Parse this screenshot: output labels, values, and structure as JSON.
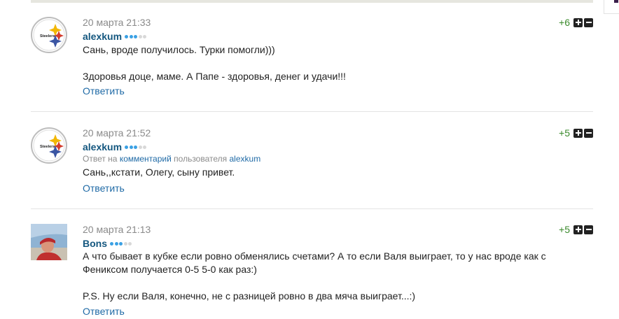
{
  "comments": [
    {
      "date": "20 марта 21:33",
      "author": "alexkum",
      "avatar": "steelers-logo",
      "rank_dots": [
        true,
        true,
        true,
        false,
        false
      ],
      "score": "+6",
      "lines": [
        "Сань, вроде получилось. Турки помогли)))",
        "",
        "Здоровья доце, маме. А Папе - здоровья, денег и удачи!!!"
      ],
      "reply_label": "Ответить"
    },
    {
      "date": "20 марта 21:52",
      "author": "alexkum",
      "avatar": "steelers-logo",
      "rank_dots": [
        true,
        true,
        true,
        false,
        false
      ],
      "reply_to": {
        "prefix": "Ответ на",
        "link": "комментарий",
        "middle": "пользователя",
        "user": "alexkum"
      },
      "score": "+5",
      "lines": [
        "Сань,,кстати, Олегу, сыну привет."
      ],
      "reply_label": "Ответить"
    },
    {
      "date": "20 марта 21:13",
      "author": "Bons",
      "avatar": "user-photo",
      "rank_dots": [
        true,
        true,
        true,
        false,
        false
      ],
      "score": "+5",
      "lines": [
        "А что бывает в кубке если ровно обменялись счетами? А то если Валя выиграет, то у нас вроде как с",
        "Фениксом получается 0-5 5-0 как раз:)",
        "",
        "P.S. Ну если Валя, конечно, не с разницей ровно в два мяча выиграет...:)"
      ],
      "reply_label": "Ответить"
    }
  ]
}
